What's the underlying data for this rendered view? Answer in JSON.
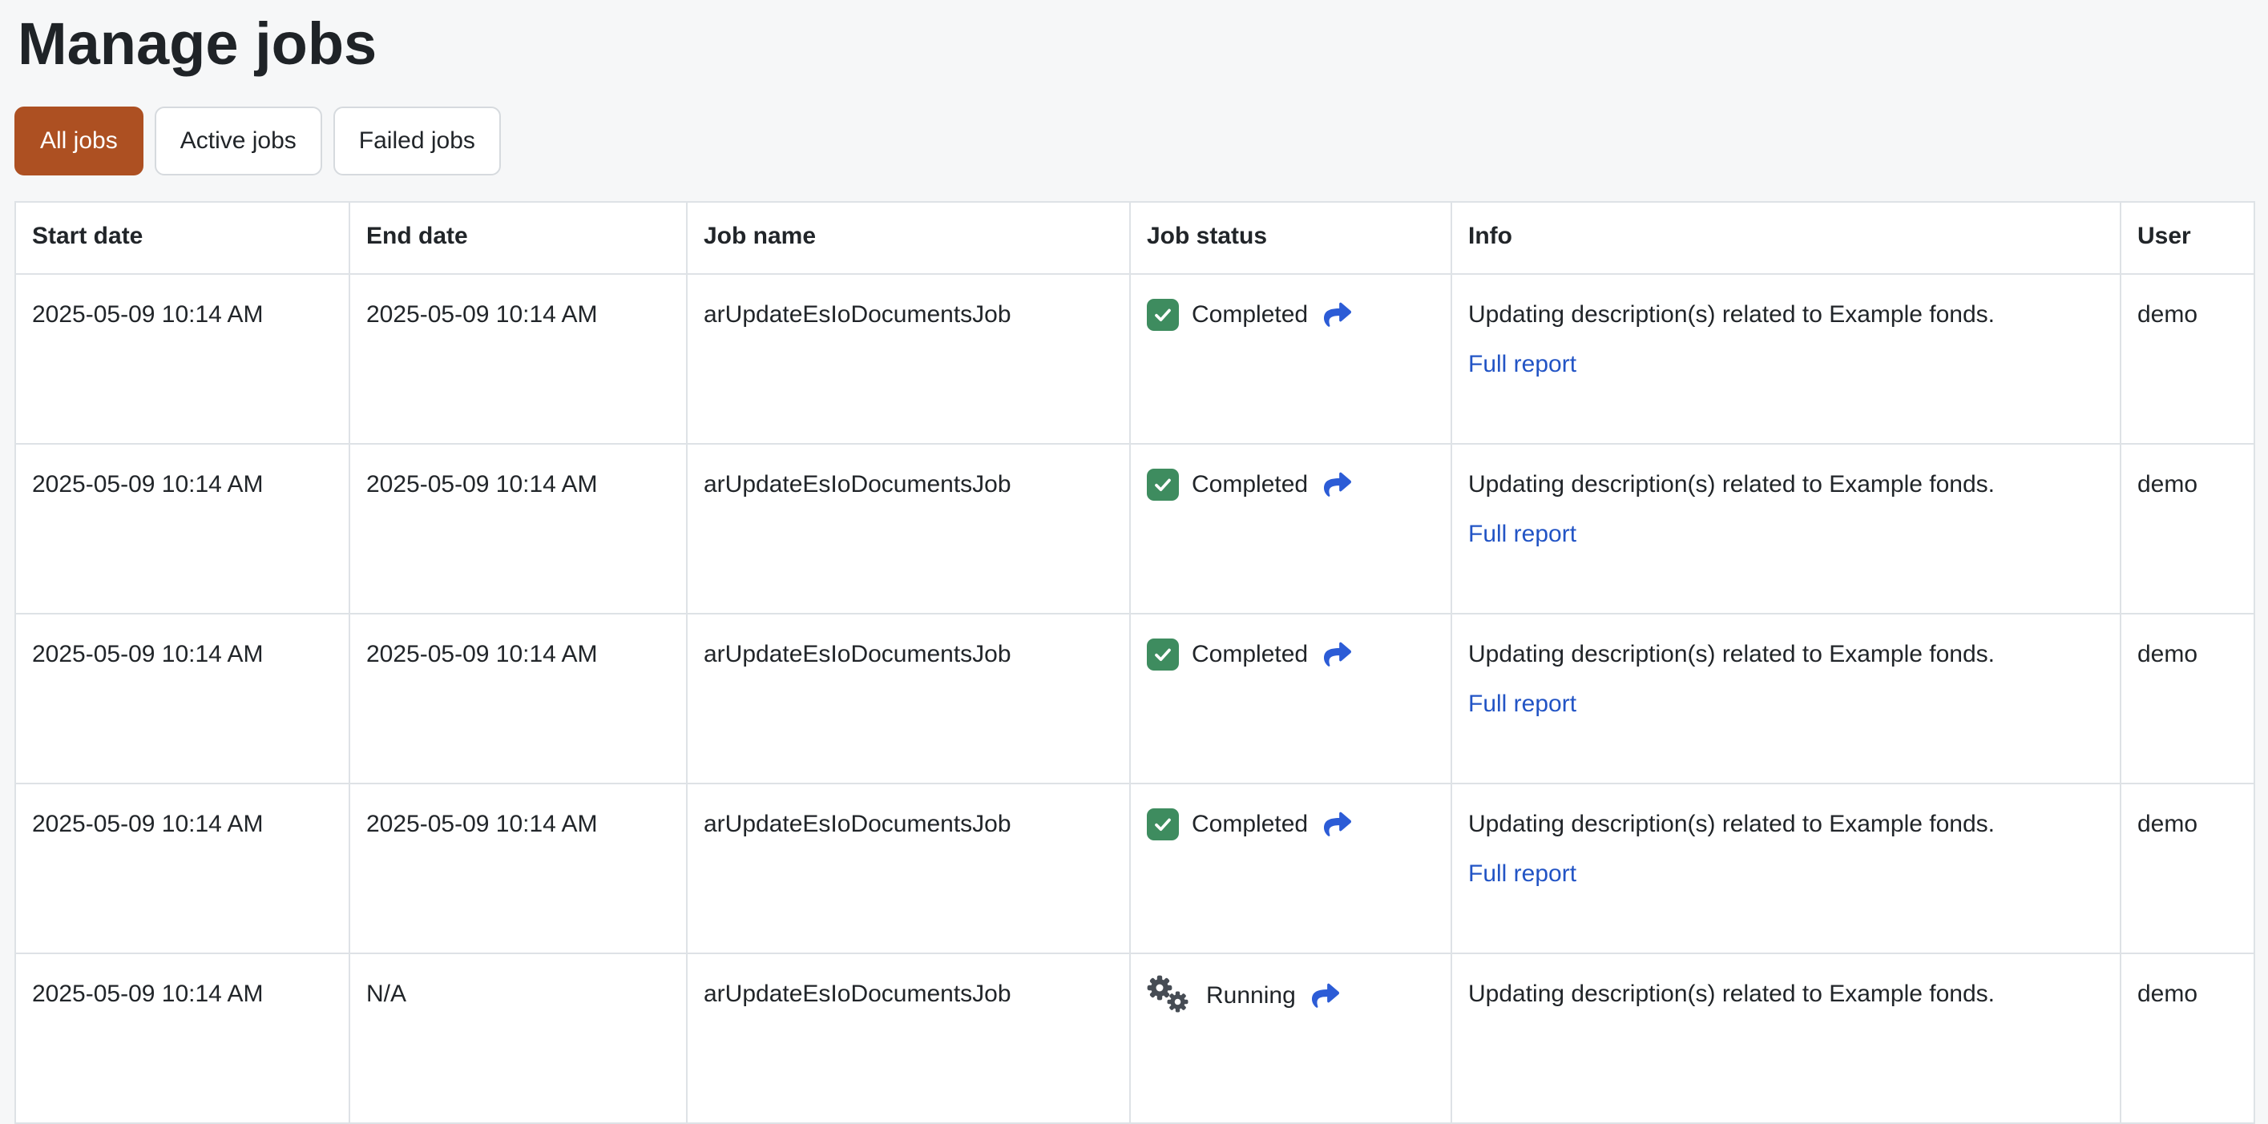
{
  "page": {
    "title": "Manage jobs"
  },
  "filters": {
    "all": "All jobs",
    "active": "Active jobs",
    "failed": "Failed jobs",
    "selected": "All jobs"
  },
  "table": {
    "headers": {
      "start": "Start date",
      "end": "End date",
      "name": "Job name",
      "status": "Job status",
      "info": "Info",
      "user": "User"
    },
    "rows": [
      {
        "start_date": "2025-05-09 10:14 AM",
        "end_date": "2025-05-09 10:14 AM",
        "job_name": "arUpdateEsIoDocumentsJob",
        "status": "Completed",
        "status_kind": "completed",
        "info": "Updating description(s) related to Example fonds.",
        "report_link": "Full report",
        "user": "demo"
      },
      {
        "start_date": "2025-05-09 10:14 AM",
        "end_date": "2025-05-09 10:14 AM",
        "job_name": "arUpdateEsIoDocumentsJob",
        "status": "Completed",
        "status_kind": "completed",
        "info": "Updating description(s) related to Example fonds.",
        "report_link": "Full report",
        "user": "demo"
      },
      {
        "start_date": "2025-05-09 10:14 AM",
        "end_date": "2025-05-09 10:14 AM",
        "job_name": "arUpdateEsIoDocumentsJob",
        "status": "Completed",
        "status_kind": "completed",
        "info": "Updating description(s) related to Example fonds.",
        "report_link": "Full report",
        "user": "demo"
      },
      {
        "start_date": "2025-05-09 10:14 AM",
        "end_date": "2025-05-09 10:14 AM",
        "job_name": "arUpdateEsIoDocumentsJob",
        "status": "Completed",
        "status_kind": "completed",
        "info": "Updating description(s) related to Example fonds.",
        "report_link": "Full report",
        "user": "demo"
      },
      {
        "start_date": "2025-05-09 10:14 AM",
        "end_date": "N/A",
        "job_name": "arUpdateEsIoDocumentsJob",
        "status": "Running",
        "status_kind": "running",
        "info": "Updating description(s) related to Example fonds.",
        "report_link": null,
        "user": "demo"
      }
    ]
  },
  "icons": {
    "completed_status": "check-square-icon",
    "running_status": "gears-icon",
    "status_detail": "share-arrow-icon"
  },
  "colors": {
    "accent": "#ad5022",
    "success": "#3e8c5f",
    "link": "#2254c5",
    "arrow": "#2c5cd6",
    "gear": "#464c54",
    "border": "#dee2e6",
    "page_bg": "#f6f7f8"
  }
}
